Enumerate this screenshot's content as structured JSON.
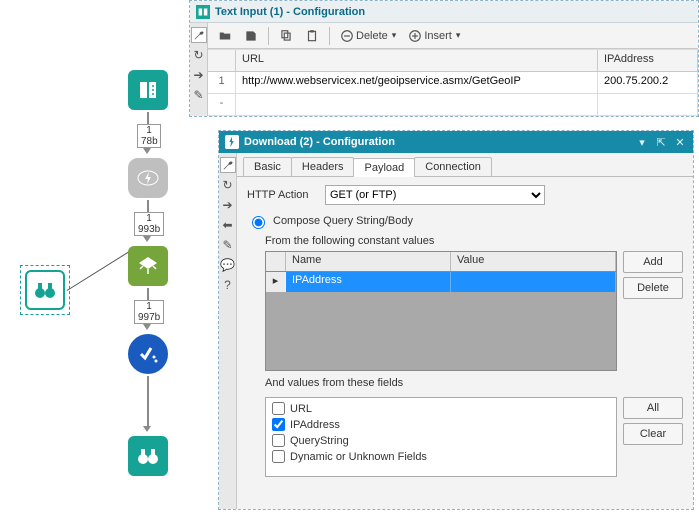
{
  "canvas": {
    "labels": {
      "l1": "1\n78b",
      "l2": "1\n993b",
      "l3": "1\n997b"
    }
  },
  "win1": {
    "title": "Text Input (1) - Configuration",
    "toolbar": {
      "delete": "Delete",
      "insert": "Insert"
    },
    "headers": {
      "col1": "URL",
      "col2": "IPAddress"
    },
    "rows": [
      {
        "num": "1",
        "url": "http://www.webservicex.net/geoipservice.asmx/GetGeoIP",
        "ip": "200.75.200.2"
      }
    ]
  },
  "win2": {
    "title": "Download (2) - Configuration",
    "tabs": {
      "basic": "Basic",
      "headers": "Headers",
      "payload": "Payload",
      "connection": "Connection"
    },
    "http_action_label": "HTTP Action",
    "http_action_value": "GET (or FTP)",
    "compose_label": "Compose Query String/Body",
    "constants_heading": "From the following constant values",
    "grid_headers": {
      "name": "Name",
      "value": "Value"
    },
    "grid_row": {
      "name": "IPAddress",
      "value": ""
    },
    "add": "Add",
    "delete": "Delete",
    "fields_heading": "And values from these fields",
    "fields": {
      "url": "URL",
      "ip": "IPAddress",
      "qs": "QueryString",
      "dyn": "Dynamic or Unknown Fields"
    },
    "all": "All",
    "clear": "Clear"
  }
}
